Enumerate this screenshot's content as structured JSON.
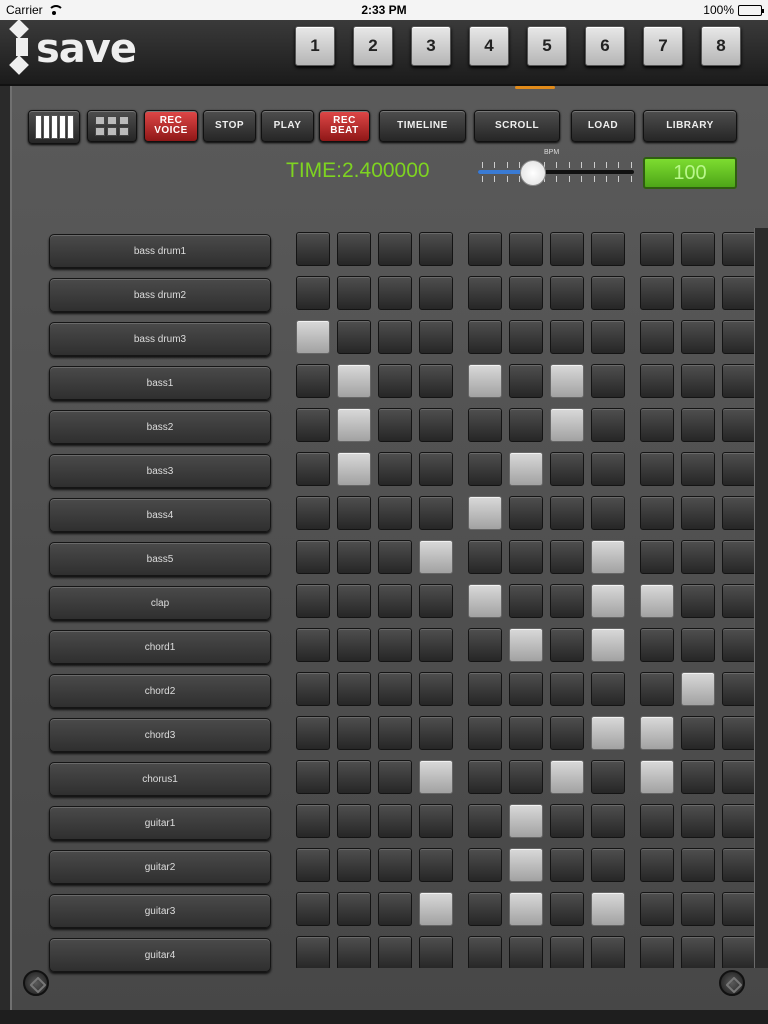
{
  "status_bar": {
    "carrier": "Carrier",
    "time": "2:33 PM",
    "battery": "100%"
  },
  "header": {
    "logo_text": "save",
    "patterns": [
      "1",
      "2",
      "3",
      "4",
      "5",
      "6",
      "7",
      "8"
    ]
  },
  "toolbar": {
    "rec_voice": "REC\nVOICE",
    "stop": "STOP",
    "play": "PLAY",
    "rec_beat": "REC\nBEAT",
    "timeline": "TIMELINE",
    "scroll": "SCROLL",
    "load": "LOAD",
    "library": "LIBRARY"
  },
  "transport": {
    "time_text": "TIME:2.400000",
    "bpm_label": "BPM",
    "bpm_value": "100",
    "bpm_slider_fraction": 0.35
  },
  "colors": {
    "accent_green": "#7ed321",
    "rec_red": "#c62828"
  },
  "tracks": [
    {
      "name": "bass drum1",
      "steps": [
        0,
        0,
        0,
        0,
        0,
        0,
        0,
        0,
        0,
        0,
        0,
        0
      ]
    },
    {
      "name": "bass drum2",
      "steps": [
        0,
        0,
        0,
        0,
        0,
        0,
        0,
        0,
        0,
        0,
        0,
        0
      ]
    },
    {
      "name": "bass drum3",
      "steps": [
        1,
        0,
        0,
        0,
        0,
        0,
        0,
        0,
        0,
        0,
        0,
        0
      ]
    },
    {
      "name": "bass1",
      "steps": [
        0,
        1,
        0,
        0,
        1,
        0,
        1,
        0,
        0,
        0,
        0,
        0
      ]
    },
    {
      "name": "bass2",
      "steps": [
        0,
        1,
        0,
        0,
        0,
        0,
        1,
        0,
        0,
        0,
        0,
        0
      ]
    },
    {
      "name": "bass3",
      "steps": [
        0,
        1,
        0,
        0,
        0,
        1,
        0,
        0,
        0,
        0,
        0,
        0
      ]
    },
    {
      "name": "bass4",
      "steps": [
        0,
        0,
        0,
        0,
        1,
        0,
        0,
        0,
        0,
        0,
        0,
        0
      ]
    },
    {
      "name": "bass5",
      "steps": [
        0,
        0,
        0,
        1,
        0,
        0,
        0,
        1,
        0,
        0,
        0,
        0
      ]
    },
    {
      "name": "clap",
      "steps": [
        0,
        0,
        0,
        0,
        1,
        0,
        0,
        1,
        1,
        0,
        0,
        0
      ]
    },
    {
      "name": "chord1",
      "steps": [
        0,
        0,
        0,
        0,
        0,
        1,
        0,
        1,
        0,
        0,
        0,
        0
      ]
    },
    {
      "name": "chord2",
      "steps": [
        0,
        0,
        0,
        0,
        0,
        0,
        0,
        0,
        0,
        1,
        0,
        0
      ]
    },
    {
      "name": "chord3",
      "steps": [
        0,
        0,
        0,
        0,
        0,
        0,
        0,
        1,
        1,
        0,
        0,
        0
      ]
    },
    {
      "name": "chorus1",
      "steps": [
        0,
        0,
        0,
        1,
        0,
        0,
        1,
        0,
        1,
        0,
        0,
        0
      ]
    },
    {
      "name": "guitar1",
      "steps": [
        0,
        0,
        0,
        0,
        0,
        1,
        0,
        0,
        0,
        0,
        0,
        0
      ]
    },
    {
      "name": "guitar2",
      "steps": [
        0,
        0,
        0,
        0,
        0,
        1,
        0,
        0,
        0,
        0,
        0,
        0
      ]
    },
    {
      "name": "guitar3",
      "steps": [
        0,
        0,
        0,
        1,
        0,
        1,
        0,
        1,
        0,
        0,
        0,
        0
      ]
    },
    {
      "name": "guitar4",
      "steps": [
        0,
        0,
        0,
        0,
        0,
        0,
        0,
        0,
        0,
        0,
        0,
        0
      ]
    }
  ]
}
